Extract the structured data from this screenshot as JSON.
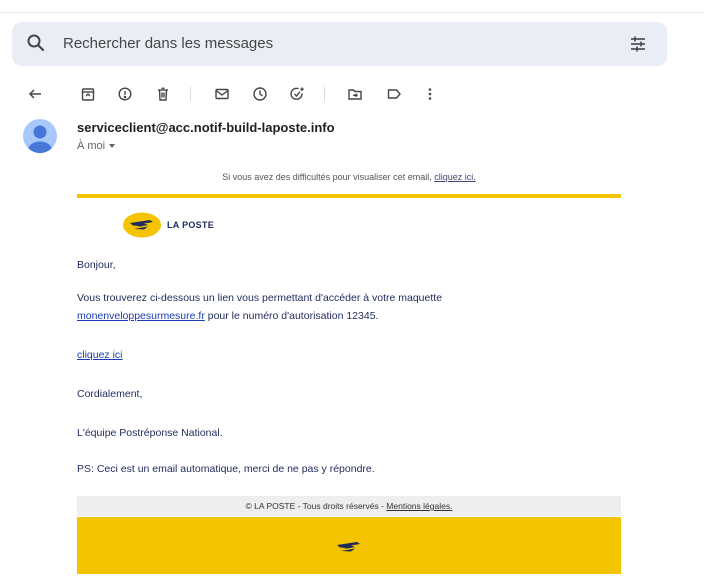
{
  "search": {
    "placeholder": "Rechercher dans les messages"
  },
  "toolbar": {
    "icons": [
      "back-arrow-icon",
      "archive-icon",
      "report-spam-icon",
      "delete-icon",
      "mark-unread-icon",
      "snooze-icon",
      "add-to-tasks-icon",
      "move-to-icon",
      "label-icon",
      "more-vert-icon"
    ]
  },
  "email": {
    "sender": "serviceclient@acc.notif-build-laposte.info",
    "recipient": "À moi",
    "notice_text": "Si vous avez des difficultés pour visualiser cet email, ",
    "notice_link": "cliquez ici.",
    "logo_text": "LA POSTE",
    "greeting": "Bonjour,",
    "para1_line1": "Vous trouverez ci-dessous un lien vous permettant d'accéder à votre maquette",
    "para1_link": "monenveloppesurmesure.fr",
    "para1_line2_rest": " pour le numéro d'autorisation 12345.",
    "cta_link": "cliquez ici",
    "closing": "Cordialement,",
    "signature": "L'équipe Postréponse National.",
    "ps": "PS: Ceci est un email automatique, merci de ne pas y répondre.",
    "footer_text": "© LA POSTE - Tous droits réservés - ",
    "footer_link": "Mentions légales."
  },
  "colors": {
    "brand_yellow": "#f5c400",
    "brand_blue": "#1f2a5c",
    "link_blue": "#1a3cb8",
    "search_bg": "#e9eef6"
  }
}
